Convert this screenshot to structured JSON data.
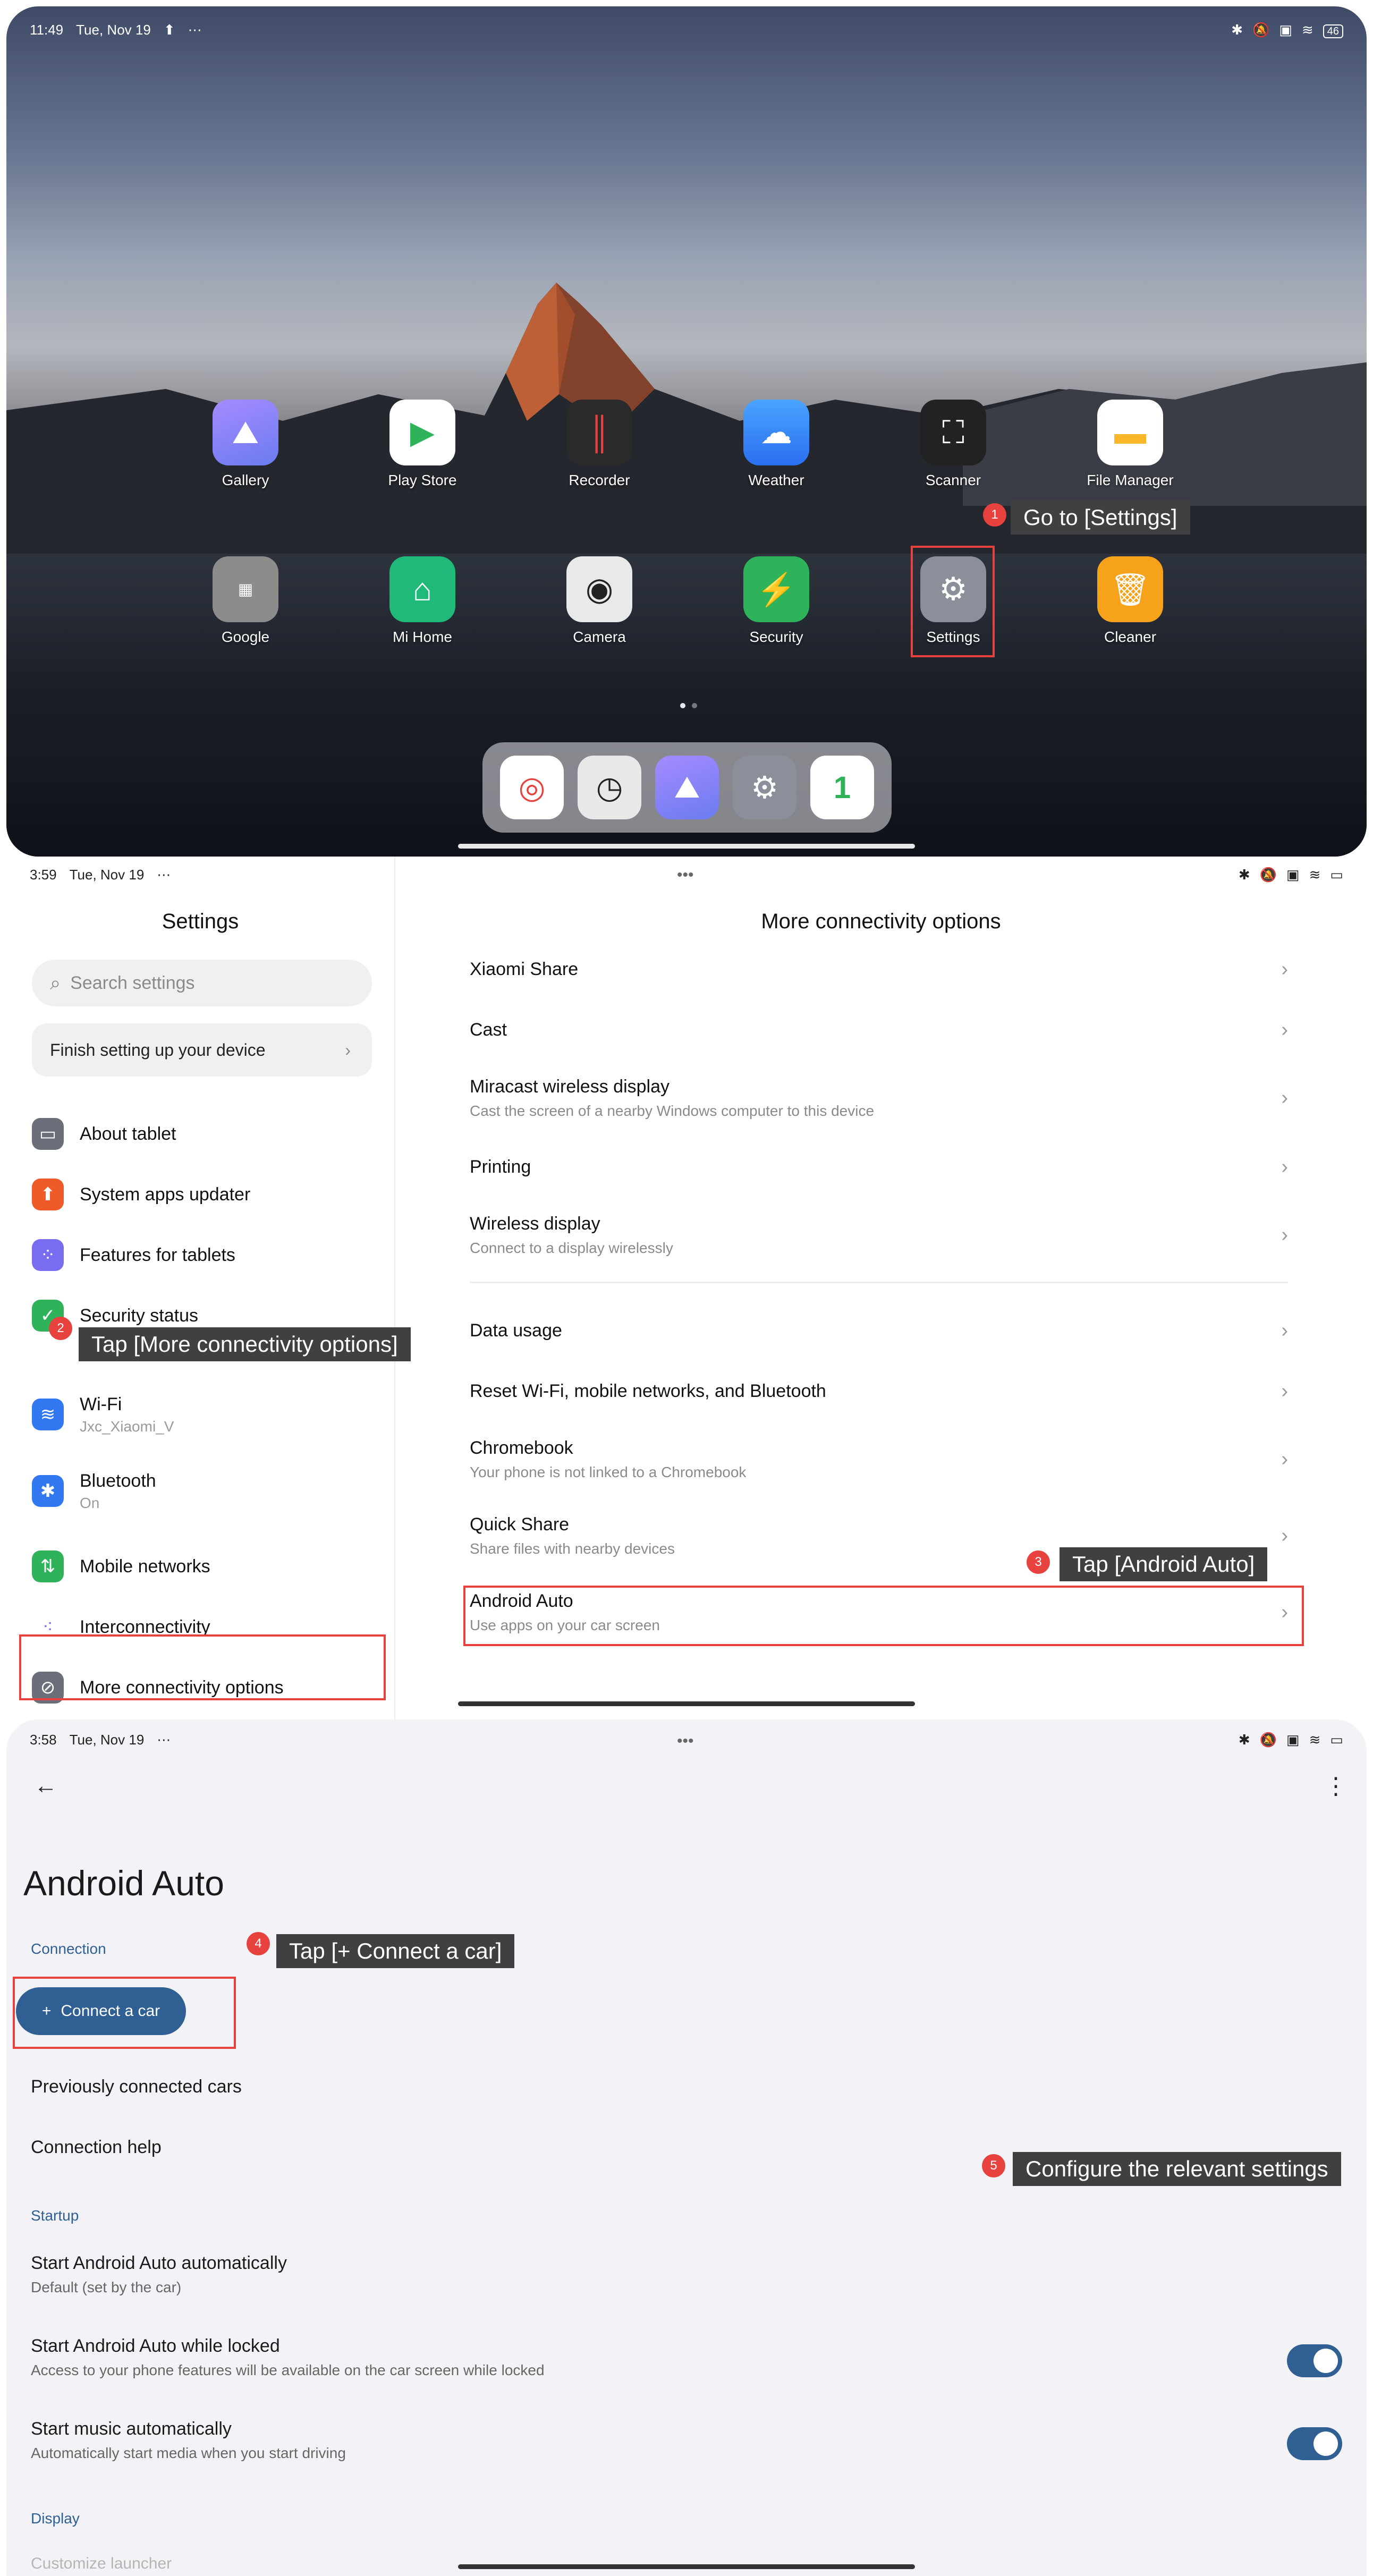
{
  "panel1": {
    "status": {
      "time": "11:49",
      "date": "Tue, Nov 19",
      "icons_left": [
        "upload-icon",
        "more-icon"
      ],
      "icons_right": [
        "bluetooth-icon",
        "mute-icon",
        "screencast-icon",
        "wifi-icon",
        "battery-icon"
      ],
      "battery": "46"
    },
    "apps_row1": [
      {
        "label": "Gallery",
        "icon": "gallery-icon",
        "color": "#7b7cf5"
      },
      {
        "label": "Play Store",
        "icon": "play-store-icon",
        "color": "#ffffff"
      },
      {
        "label": "Recorder",
        "icon": "recorder-icon",
        "color": "#2a2a2a"
      },
      {
        "label": "Weather",
        "icon": "weather-icon",
        "color": "#3d8ef5"
      },
      {
        "label": "Scanner",
        "icon": "scanner-icon",
        "color": "#222222"
      },
      {
        "label": "File Manager",
        "icon": "folder-icon",
        "color": "#fbb72a"
      }
    ],
    "apps_row2": [
      {
        "label": "Google",
        "icon": "google-folder-icon",
        "color": "#8c8c8c"
      },
      {
        "label": "Mi Home",
        "icon": "mi-home-icon",
        "color": "#1fb97a"
      },
      {
        "label": "Camera",
        "icon": "camera-icon",
        "color": "#e9e9e9"
      },
      {
        "label": "Security",
        "icon": "security-icon",
        "color": "#2fb35a"
      },
      {
        "label": "Settings",
        "icon": "settings-gear-icon",
        "color": "#8a8f99"
      },
      {
        "label": "Cleaner",
        "icon": "cleaner-icon",
        "color": "#f7a21b"
      }
    ],
    "dock": [
      "chrome-icon",
      "clock-icon",
      "gallery-icon",
      "settings-gear-icon",
      "one-app-icon"
    ],
    "step1": {
      "number": "1",
      "text": "Go to [Settings]"
    }
  },
  "panel2": {
    "status": {
      "time": "3:59",
      "date": "Tue, Nov 19"
    },
    "sidebar": {
      "title": "Settings",
      "search_placeholder": "Search settings",
      "finish": "Finish setting up your device",
      "items": [
        {
          "label": "About tablet",
          "sub": "",
          "color": "#6b6f7a",
          "icon": "tablet-icon"
        },
        {
          "label": "System apps updater",
          "sub": "",
          "color": "#f05a28",
          "icon": "update-arrow-icon"
        },
        {
          "label": "Features for tablets",
          "sub": "",
          "color": "#7a6cf0",
          "icon": "grid-icon"
        },
        {
          "label": "Security status",
          "sub": "",
          "color": "#2fb35a",
          "icon": "shield-check-icon"
        },
        {
          "label": "Wi-Fi",
          "sub": "Jxc_Xiaomi_V",
          "color": "#3278f0",
          "icon": "wifi-icon"
        },
        {
          "label": "Bluetooth",
          "sub": "On",
          "color": "#3278f0",
          "icon": "bluetooth-icon"
        },
        {
          "label": "Mobile networks",
          "sub": "",
          "color": "#2fb35a",
          "icon": "signal-icon"
        },
        {
          "label": "Interconnectivity",
          "sub": "",
          "color": "#ffffff",
          "icon": "interconnect-icon"
        },
        {
          "label": "More connectivity options",
          "sub": "",
          "color": "#6b6f7a",
          "icon": "link-icon"
        }
      ]
    },
    "main": {
      "title": "More connectivity options",
      "rows": [
        {
          "title": "Xiaomi Share",
          "sub": ""
        },
        {
          "title": "Cast",
          "sub": ""
        },
        {
          "title": "Miracast wireless display",
          "sub": "Cast the screen of a nearby Windows computer to this device"
        },
        {
          "title": "Printing",
          "sub": ""
        },
        {
          "title": "Wireless display",
          "sub": "Connect to a display wirelessly"
        },
        {
          "title": "Data usage",
          "sub": ""
        },
        {
          "title": "Reset Wi-Fi, mobile networks, and Bluetooth",
          "sub": ""
        },
        {
          "title": "Chromebook",
          "sub": "Your phone is not linked to a Chromebook"
        },
        {
          "title": "Quick Share",
          "sub": "Share files with nearby devices"
        },
        {
          "title": "Android Auto",
          "sub": "Use apps on your car screen"
        }
      ]
    },
    "step2": {
      "number": "2",
      "text": "Tap [More connectivity options]"
    },
    "step3": {
      "number": "3",
      "text": "Tap [Android Auto]"
    }
  },
  "panel3": {
    "status": {
      "time": "3:58",
      "date": "Tue, Nov 19"
    },
    "title": "Android Auto",
    "section_connection": "Connection",
    "connect_button": "Connect a car",
    "previously": "Previously connected cars",
    "help": "Connection help",
    "section_startup": "Startup",
    "start_auto": {
      "title": "Start Android Auto automatically",
      "sub": "Default (set by the car)"
    },
    "start_locked": {
      "title": "Start Android Auto while locked",
      "sub": "Access to your phone features will be available on the car screen while locked",
      "on": true
    },
    "start_music": {
      "title": "Start music automatically",
      "sub": "Automatically start media when you start driving",
      "on": true
    },
    "section_display": "Display",
    "customize": "Customize launcher",
    "step4": {
      "number": "4",
      "text": "Tap [+ Connect a car]"
    },
    "step5": {
      "number": "5",
      "text": "Configure the relevant settings"
    }
  }
}
